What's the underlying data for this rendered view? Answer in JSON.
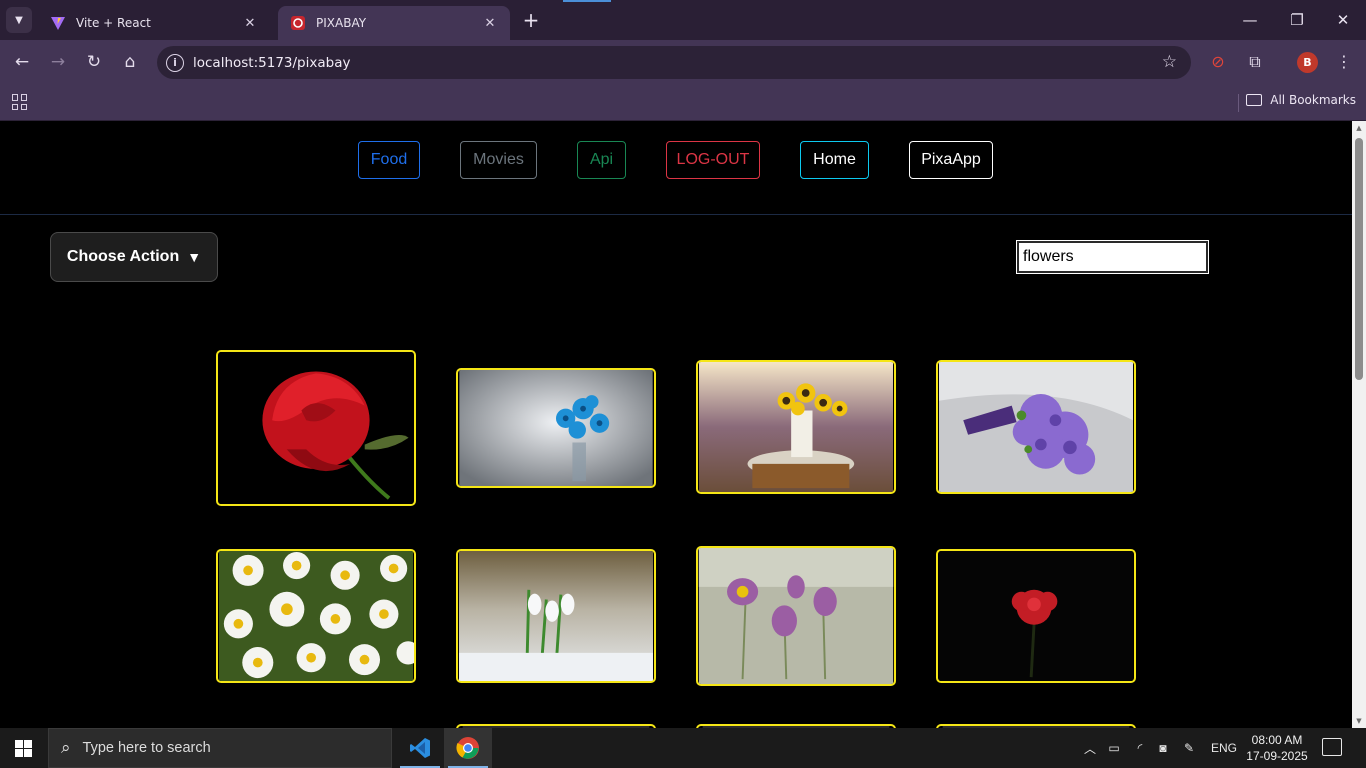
{
  "browser": {
    "tabs": [
      {
        "title": "Vite + React",
        "active": false
      },
      {
        "title": "PIXABAY",
        "active": true
      }
    ],
    "url": "localhost:5173/pixabay",
    "profile_initial": "B",
    "all_bookmarks_label": "All Bookmarks"
  },
  "nav": {
    "links": [
      {
        "label": "Food",
        "color": "#1f6feb"
      },
      {
        "label": "Movies",
        "color": "#6c757d"
      },
      {
        "label": "Api",
        "color": "#198754"
      },
      {
        "label": "LOG-OUT",
        "color": "#dc3545"
      },
      {
        "label": "Home",
        "color": "#0dcaf0"
      },
      {
        "label": "PixaApp",
        "color": "#ffffff"
      }
    ]
  },
  "controls": {
    "action_label": "Choose Action",
    "search_value": "flowers"
  },
  "gallery": {
    "border_color": "#f5e616",
    "images": [
      {
        "subject": "red rose"
      },
      {
        "subject": "blue flowers"
      },
      {
        "subject": "sunflowers in vase"
      },
      {
        "subject": "purple bouquet"
      },
      {
        "subject": "daisies"
      },
      {
        "subject": "snowdrops"
      },
      {
        "subject": "pasque flowers"
      },
      {
        "subject": "red flower on black"
      }
    ]
  },
  "taskbar": {
    "search_placeholder": "Type here to search",
    "language": "ENG",
    "time": "08:00 AM",
    "date": "17-09-2025"
  }
}
